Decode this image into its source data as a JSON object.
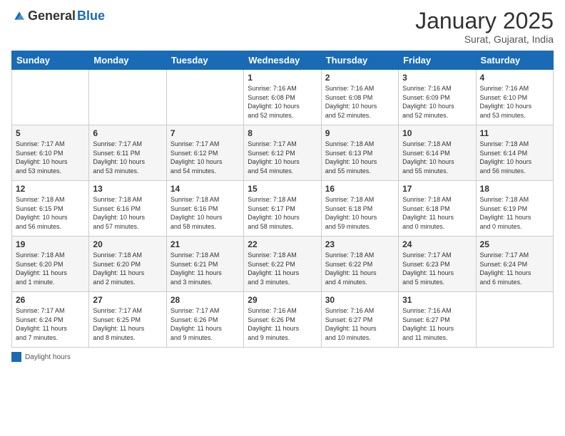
{
  "header": {
    "logo_general": "General",
    "logo_blue": "Blue",
    "month_title": "January 2025",
    "location": "Surat, Gujarat, India"
  },
  "days_of_week": [
    "Sunday",
    "Monday",
    "Tuesday",
    "Wednesday",
    "Thursday",
    "Friday",
    "Saturday"
  ],
  "weeks": [
    [
      {
        "day": "",
        "info": ""
      },
      {
        "day": "",
        "info": ""
      },
      {
        "day": "",
        "info": ""
      },
      {
        "day": "1",
        "info": "Sunrise: 7:16 AM\nSunset: 6:08 PM\nDaylight: 10 hours\nand 52 minutes."
      },
      {
        "day": "2",
        "info": "Sunrise: 7:16 AM\nSunset: 6:08 PM\nDaylight: 10 hours\nand 52 minutes."
      },
      {
        "day": "3",
        "info": "Sunrise: 7:16 AM\nSunset: 6:09 PM\nDaylight: 10 hours\nand 52 minutes."
      },
      {
        "day": "4",
        "info": "Sunrise: 7:16 AM\nSunset: 6:10 PM\nDaylight: 10 hours\nand 53 minutes."
      }
    ],
    [
      {
        "day": "5",
        "info": "Sunrise: 7:17 AM\nSunset: 6:10 PM\nDaylight: 10 hours\nand 53 minutes."
      },
      {
        "day": "6",
        "info": "Sunrise: 7:17 AM\nSunset: 6:11 PM\nDaylight: 10 hours\nand 53 minutes."
      },
      {
        "day": "7",
        "info": "Sunrise: 7:17 AM\nSunset: 6:12 PM\nDaylight: 10 hours\nand 54 minutes."
      },
      {
        "day": "8",
        "info": "Sunrise: 7:17 AM\nSunset: 6:12 PM\nDaylight: 10 hours\nand 54 minutes."
      },
      {
        "day": "9",
        "info": "Sunrise: 7:18 AM\nSunset: 6:13 PM\nDaylight: 10 hours\nand 55 minutes."
      },
      {
        "day": "10",
        "info": "Sunrise: 7:18 AM\nSunset: 6:14 PM\nDaylight: 10 hours\nand 55 minutes."
      },
      {
        "day": "11",
        "info": "Sunrise: 7:18 AM\nSunset: 6:14 PM\nDaylight: 10 hours\nand 56 minutes."
      }
    ],
    [
      {
        "day": "12",
        "info": "Sunrise: 7:18 AM\nSunset: 6:15 PM\nDaylight: 10 hours\nand 56 minutes."
      },
      {
        "day": "13",
        "info": "Sunrise: 7:18 AM\nSunset: 6:16 PM\nDaylight: 10 hours\nand 57 minutes."
      },
      {
        "day": "14",
        "info": "Sunrise: 7:18 AM\nSunset: 6:16 PM\nDaylight: 10 hours\nand 58 minutes."
      },
      {
        "day": "15",
        "info": "Sunrise: 7:18 AM\nSunset: 6:17 PM\nDaylight: 10 hours\nand 58 minutes."
      },
      {
        "day": "16",
        "info": "Sunrise: 7:18 AM\nSunset: 6:18 PM\nDaylight: 10 hours\nand 59 minutes."
      },
      {
        "day": "17",
        "info": "Sunrise: 7:18 AM\nSunset: 6:18 PM\nDaylight: 11 hours\nand 0 minutes."
      },
      {
        "day": "18",
        "info": "Sunrise: 7:18 AM\nSunset: 6:19 PM\nDaylight: 11 hours\nand 0 minutes."
      }
    ],
    [
      {
        "day": "19",
        "info": "Sunrise: 7:18 AM\nSunset: 6:20 PM\nDaylight: 11 hours\nand 1 minute."
      },
      {
        "day": "20",
        "info": "Sunrise: 7:18 AM\nSunset: 6:20 PM\nDaylight: 11 hours\nand 2 minutes."
      },
      {
        "day": "21",
        "info": "Sunrise: 7:18 AM\nSunset: 6:21 PM\nDaylight: 11 hours\nand 3 minutes."
      },
      {
        "day": "22",
        "info": "Sunrise: 7:18 AM\nSunset: 6:22 PM\nDaylight: 11 hours\nand 3 minutes."
      },
      {
        "day": "23",
        "info": "Sunrise: 7:18 AM\nSunset: 6:22 PM\nDaylight: 11 hours\nand 4 minutes."
      },
      {
        "day": "24",
        "info": "Sunrise: 7:17 AM\nSunset: 6:23 PM\nDaylight: 11 hours\nand 5 minutes."
      },
      {
        "day": "25",
        "info": "Sunrise: 7:17 AM\nSunset: 6:24 PM\nDaylight: 11 hours\nand 6 minutes."
      }
    ],
    [
      {
        "day": "26",
        "info": "Sunrise: 7:17 AM\nSunset: 6:24 PM\nDaylight: 11 hours\nand 7 minutes."
      },
      {
        "day": "27",
        "info": "Sunrise: 7:17 AM\nSunset: 6:25 PM\nDaylight: 11 hours\nand 8 minutes."
      },
      {
        "day": "28",
        "info": "Sunrise: 7:17 AM\nSunset: 6:26 PM\nDaylight: 11 hours\nand 9 minutes."
      },
      {
        "day": "29",
        "info": "Sunrise: 7:16 AM\nSunset: 6:26 PM\nDaylight: 11 hours\nand 9 minutes."
      },
      {
        "day": "30",
        "info": "Sunrise: 7:16 AM\nSunset: 6:27 PM\nDaylight: 11 hours\nand 10 minutes."
      },
      {
        "day": "31",
        "info": "Sunrise: 7:16 AM\nSunset: 6:27 PM\nDaylight: 11 hours\nand 11 minutes."
      },
      {
        "day": "",
        "info": ""
      }
    ]
  ],
  "footer": {
    "label": "Daylight hours"
  }
}
